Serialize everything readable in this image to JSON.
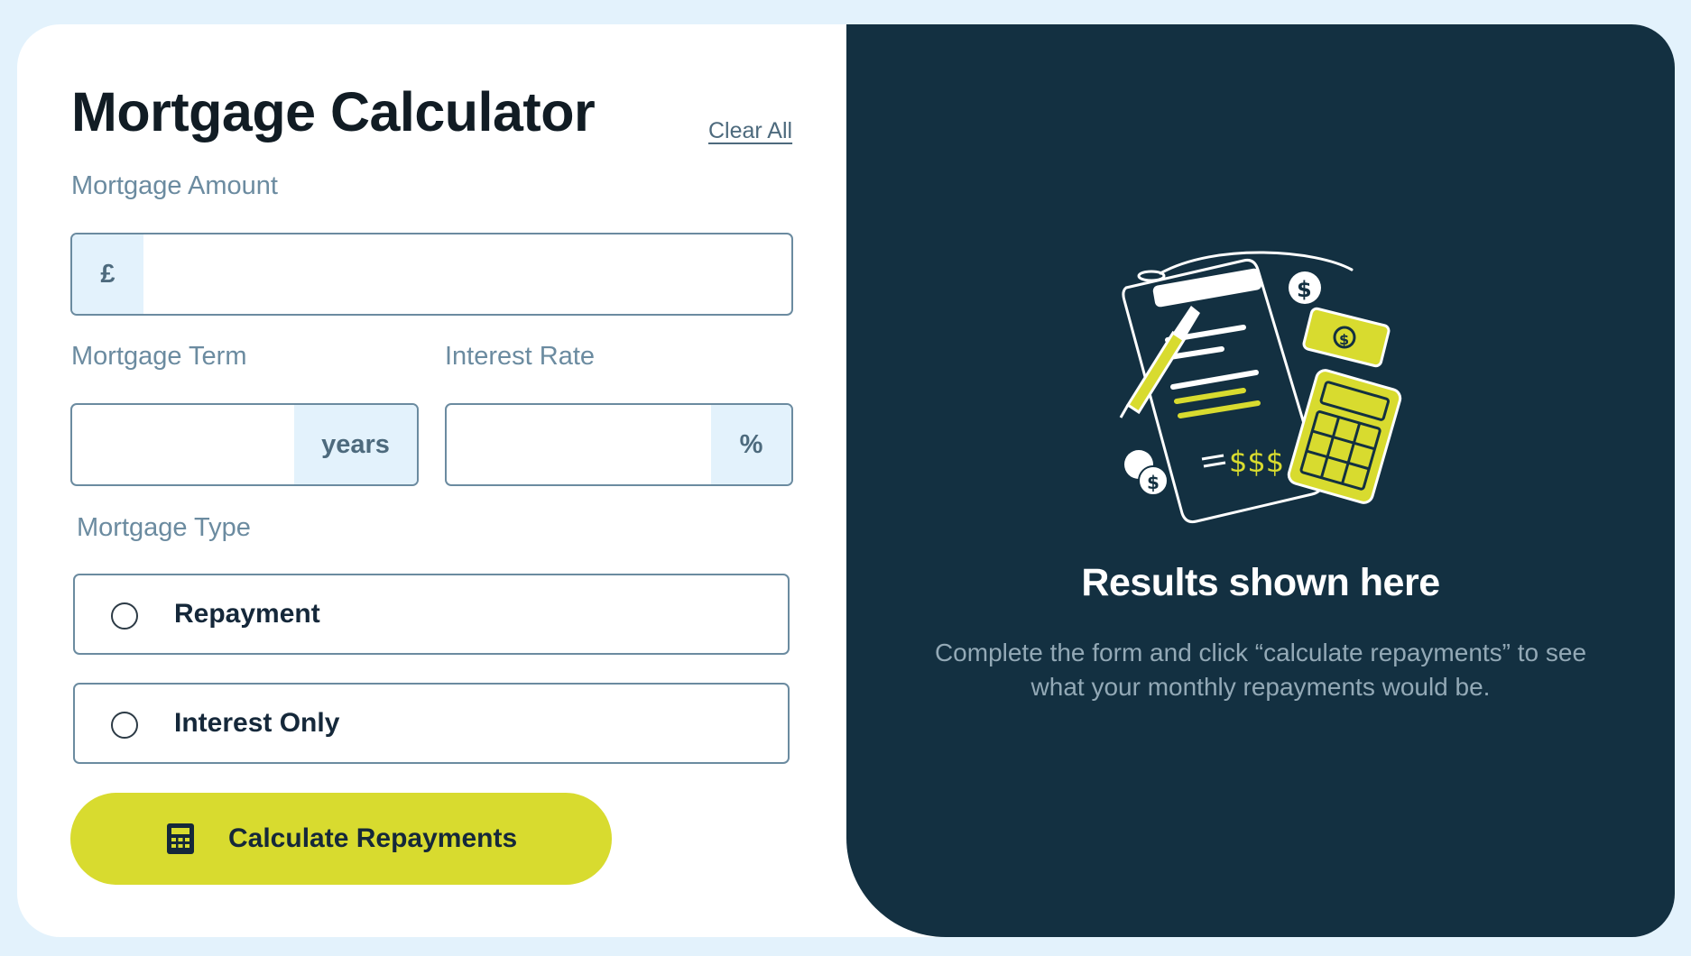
{
  "header": {
    "title": "Mortgage Calculator",
    "clear_label": "Clear All"
  },
  "amount": {
    "label": "Mortgage Amount",
    "currency": "£",
    "value": ""
  },
  "term": {
    "label": "Mortgage Term",
    "unit": "years",
    "value": ""
  },
  "rate": {
    "label": "Interest Rate",
    "unit": "%",
    "value": ""
  },
  "mortgage_type": {
    "label": "Mortgage Type",
    "options": [
      {
        "label": "Repayment",
        "selected": false
      },
      {
        "label": "Interest Only",
        "selected": false
      }
    ]
  },
  "submit": {
    "label": "Calculate Repayments",
    "icon": "calculator-icon"
  },
  "results": {
    "title": "Results shown here",
    "description": "Complete the form and click “calculate repayments” to see what your monthly repayments would be.",
    "illustration": "empty-results-illustration"
  },
  "colors": {
    "page_bg": "#e3f2fc",
    "accent_lime": "#d8db2f",
    "panel_dark": "#133041",
    "label_slate": "#6b8ba0",
    "text_dark": "#111c24"
  }
}
